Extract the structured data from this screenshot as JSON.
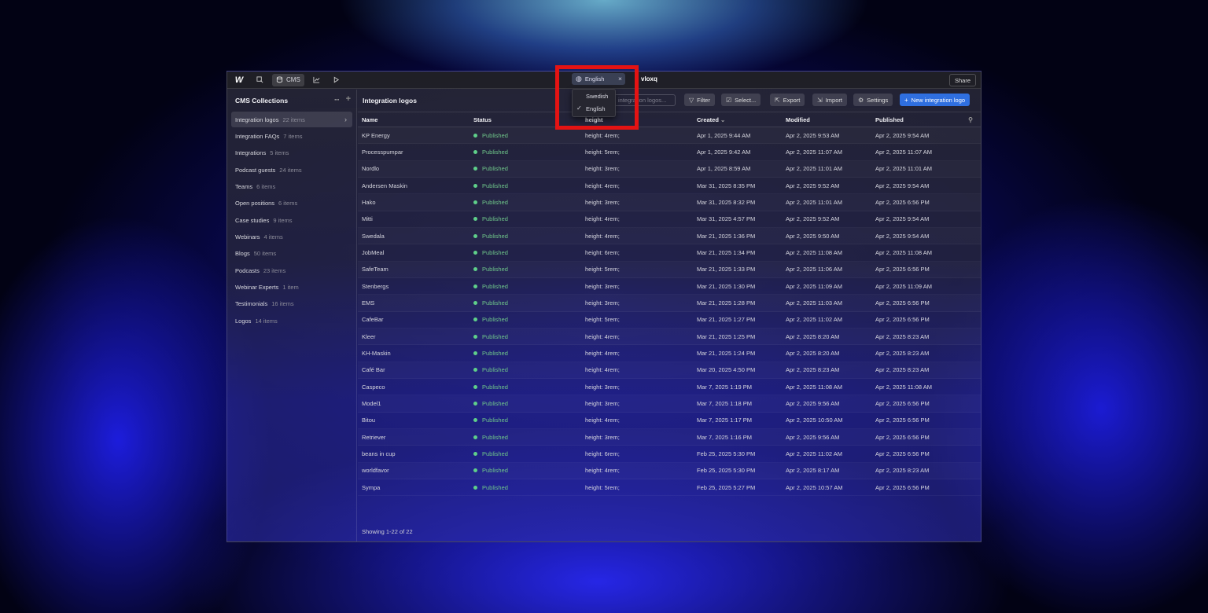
{
  "topbar": {
    "nav": [
      {
        "label": ""
      },
      {
        "label": "CMS"
      },
      {
        "label": ""
      },
      {
        "label": ""
      }
    ],
    "project_title": "vloxq",
    "share_label": "Share",
    "locale": "English"
  },
  "locale_menu": {
    "options": [
      "Swedish",
      "English"
    ],
    "selected": "English"
  },
  "sidebar": {
    "title": "CMS Collections",
    "items": [
      {
        "label": "Integration logos",
        "count": "22 items",
        "active": true
      },
      {
        "label": "Integration FAQs",
        "count": "7 items"
      },
      {
        "label": "Integrations",
        "count": "5 items"
      },
      {
        "label": "Podcast guests",
        "count": "24 items"
      },
      {
        "label": "Teams",
        "count": "6 items"
      },
      {
        "label": "Open positions",
        "count": "6 items"
      },
      {
        "label": "Case studies",
        "count": "9 items"
      },
      {
        "label": "Webinars",
        "count": "4 items"
      },
      {
        "label": "Blogs",
        "count": "50 items"
      },
      {
        "label": "Podcasts",
        "count": "23 items"
      },
      {
        "label": "Webinar Experts",
        "count": "1 item"
      },
      {
        "label": "Testimonials",
        "count": "16 items"
      },
      {
        "label": "Logos",
        "count": "14 items"
      }
    ]
  },
  "main": {
    "title": "Integration logos",
    "search_placeholder": "integration logos...",
    "toolbar": {
      "filter": "Filter",
      "select": "Select...",
      "export": "Export",
      "import": "Import",
      "settings": "Settings",
      "new": "New integration logo"
    },
    "columns": {
      "name": "Name",
      "status": "Status",
      "height": "height",
      "created": "Created",
      "modified": "Modified",
      "published": "Published"
    },
    "rows": [
      {
        "name": "KP Energy",
        "status": "Published",
        "height": "height: 4rem;",
        "created": "Apr 1, 2025 9:44 AM",
        "modified": "Apr 2, 2025 9:53 AM",
        "published": "Apr 2, 2025 9:54 AM"
      },
      {
        "name": "Processpumpar",
        "status": "Published",
        "height": "height: 5rem;",
        "created": "Apr 1, 2025 9:42 AM",
        "modified": "Apr 2, 2025 11:07 AM",
        "published": "Apr 2, 2025 11:07 AM"
      },
      {
        "name": "Nordlo",
        "status": "Published",
        "height": "height: 3rem;",
        "created": "Apr 1, 2025 8:59 AM",
        "modified": "Apr 2, 2025 11:01 AM",
        "published": "Apr 2, 2025 11:01 AM"
      },
      {
        "name": "Andersen Maskin",
        "status": "Published",
        "height": "height: 4rem;",
        "created": "Mar 31, 2025 8:35 PM",
        "modified": "Apr 2, 2025 9:52 AM",
        "published": "Apr 2, 2025 9:54 AM"
      },
      {
        "name": "Hako",
        "status": "Published",
        "height": "height: 3rem;",
        "created": "Mar 31, 2025 8:32 PM",
        "modified": "Apr 2, 2025 11:01 AM",
        "published": "Apr 2, 2025 6:56 PM"
      },
      {
        "name": "Mitti",
        "status": "Published",
        "height": "height: 4rem;",
        "created": "Mar 31, 2025 4:57 PM",
        "modified": "Apr 2, 2025 9:52 AM",
        "published": "Apr 2, 2025 9:54 AM"
      },
      {
        "name": "Swedala",
        "status": "Published",
        "height": "height: 4rem;",
        "created": "Mar 21, 2025 1:36 PM",
        "modified": "Apr 2, 2025 9:50 AM",
        "published": "Apr 2, 2025 9:54 AM"
      },
      {
        "name": "JobMeal",
        "status": "Published",
        "height": "height: 6rem;",
        "created": "Mar 21, 2025 1:34 PM",
        "modified": "Apr 2, 2025 11:08 AM",
        "published": "Apr 2, 2025 11:08 AM"
      },
      {
        "name": "SafeTeam",
        "status": "Published",
        "height": "height: 5rem;",
        "created": "Mar 21, 2025 1:33 PM",
        "modified": "Apr 2, 2025 11:06 AM",
        "published": "Apr 2, 2025 6:56 PM"
      },
      {
        "name": "Stenbergs",
        "status": "Published",
        "height": "height: 3rem;",
        "created": "Mar 21, 2025 1:30 PM",
        "modified": "Apr 2, 2025 11:09 AM",
        "published": "Apr 2, 2025 11:09 AM"
      },
      {
        "name": "EMS",
        "status": "Published",
        "height": "height: 3rem;",
        "created": "Mar 21, 2025 1:28 PM",
        "modified": "Apr 2, 2025 11:03 AM",
        "published": "Apr 2, 2025 6:56 PM"
      },
      {
        "name": "CafeBar",
        "status": "Published",
        "height": "height: 5rem;",
        "created": "Mar 21, 2025 1:27 PM",
        "modified": "Apr 2, 2025 11:02 AM",
        "published": "Apr 2, 2025 6:56 PM"
      },
      {
        "name": "Kleer",
        "status": "Published",
        "height": "height: 4rem;",
        "created": "Mar 21, 2025 1:25 PM",
        "modified": "Apr 2, 2025 8:20 AM",
        "published": "Apr 2, 2025 8:23 AM"
      },
      {
        "name": "KH-Maskin",
        "status": "Published",
        "height": "height: 4rem;",
        "created": "Mar 21, 2025 1:24 PM",
        "modified": "Apr 2, 2025 8:20 AM",
        "published": "Apr 2, 2025 8:23 AM"
      },
      {
        "name": "Café Bar",
        "status": "Published",
        "height": "height: 4rem;",
        "created": "Mar 20, 2025 4:50 PM",
        "modified": "Apr 2, 2025 8:23 AM",
        "published": "Apr 2, 2025 8:23 AM"
      },
      {
        "name": "Caspeco",
        "status": "Published",
        "height": "height: 3rem;",
        "created": "Mar 7, 2025 1:19 PM",
        "modified": "Apr 2, 2025 11:08 AM",
        "published": "Apr 2, 2025 11:08 AM"
      },
      {
        "name": "Model1",
        "status": "Published",
        "height": "height: 3rem;",
        "created": "Mar 7, 2025 1:18 PM",
        "modified": "Apr 2, 2025 9:56 AM",
        "published": "Apr 2, 2025 6:56 PM"
      },
      {
        "name": "Bitou",
        "status": "Published",
        "height": "height: 4rem;",
        "created": "Mar 7, 2025 1:17 PM",
        "modified": "Apr 2, 2025 10:50 AM",
        "published": "Apr 2, 2025 6:56 PM"
      },
      {
        "name": "Retriever",
        "status": "Published",
        "height": "height: 3rem;",
        "created": "Mar 7, 2025 1:16 PM",
        "modified": "Apr 2, 2025 9:56 AM",
        "published": "Apr 2, 2025 6:56 PM"
      },
      {
        "name": "beans in cup",
        "status": "Published",
        "height": "height: 6rem;",
        "created": "Feb 25, 2025 5:30 PM",
        "modified": "Apr 2, 2025 11:02 AM",
        "published": "Apr 2, 2025 6:56 PM"
      },
      {
        "name": "worldfavor",
        "status": "Published",
        "height": "height: 4rem;",
        "created": "Feb 25, 2025 5:30 PM",
        "modified": "Apr 2, 2025 8:17 AM",
        "published": "Apr 2, 2025 8:23 AM"
      },
      {
        "name": "Sympa",
        "status": "Published",
        "height": "height: 5rem;",
        "created": "Feb 25, 2025 5:27 PM",
        "modified": "Apr 2, 2025 10:57 AM",
        "published": "Apr 2, 2025 6:56 PM"
      }
    ],
    "footer": "Showing 1-22 of 22"
  },
  "colors": {
    "accent": "#2f6fe0",
    "published_status": "#5fd08a",
    "highlight_box": "#e41313"
  }
}
